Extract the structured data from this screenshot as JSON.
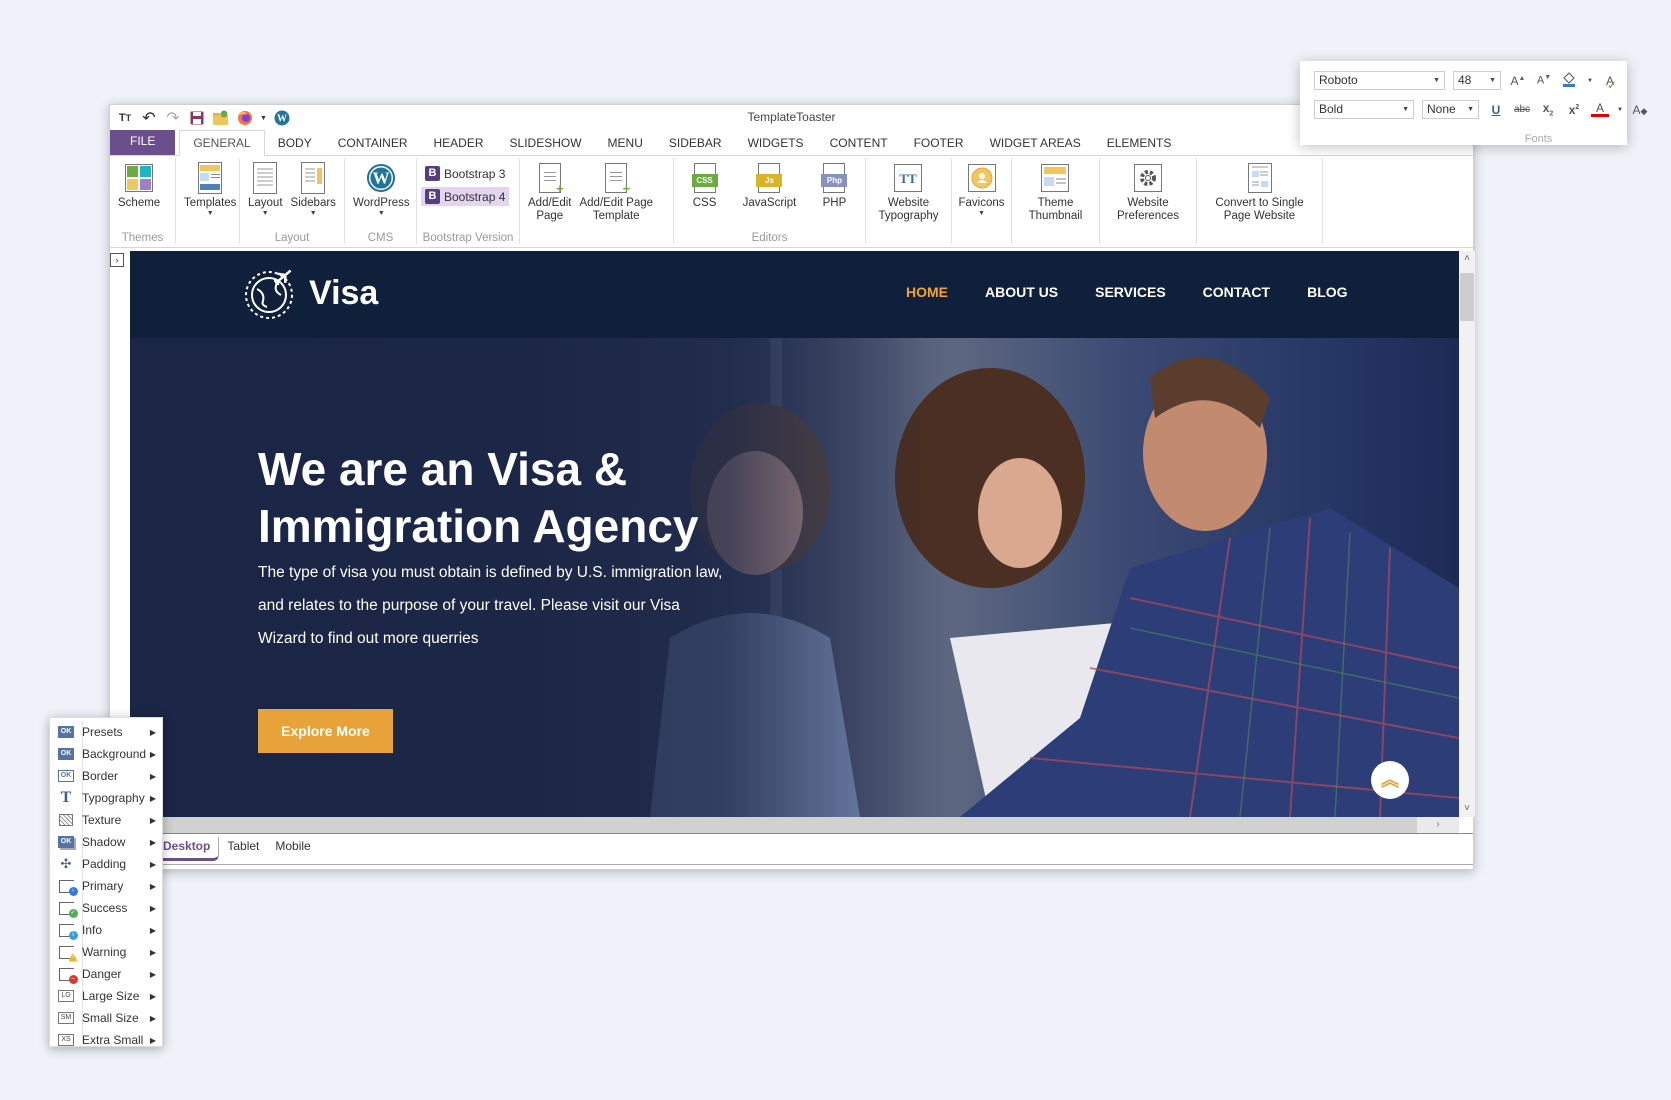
{
  "app": {
    "title": "TemplateToaster",
    "quick_access": [
      {
        "icon": "text-size-icon",
        "glyph": "TT"
      },
      {
        "icon": "undo-icon",
        "glyph": "↶"
      },
      {
        "icon": "redo-icon",
        "glyph": "↷"
      },
      {
        "icon": "save-icon",
        "glyph": "💾"
      },
      {
        "icon": "open-folder-icon",
        "glyph": "📂"
      },
      {
        "icon": "firefox-preview-icon",
        "glyph": "🦊"
      },
      {
        "icon": "wordpress-icon",
        "glyph": "W"
      }
    ]
  },
  "tabs": {
    "file": "FILE",
    "items": [
      "GENERAL",
      "BODY",
      "CONTAINER",
      "HEADER",
      "SLIDESHOW",
      "MENU",
      "SIDEBAR",
      "WIDGETS",
      "CONTENT",
      "FOOTER",
      "WIDGET AREAS",
      "ELEMENTS"
    ],
    "active": "GENERAL"
  },
  "ribbon": {
    "themes": {
      "label": "Themes",
      "scheme": "Scheme"
    },
    "templates": {
      "label": "Templates"
    },
    "layout": {
      "label": "Layout",
      "layout": "Layout",
      "sidebars": "Sidebars"
    },
    "cms": {
      "label": "CMS",
      "wordpress": "WordPress"
    },
    "bootstrap": {
      "label": "Bootstrap Version",
      "b3": "Bootstrap 3",
      "b4": "Bootstrap 4",
      "badge": "B",
      "selected": "Bootstrap 4"
    },
    "pages": {
      "add_edit_page_1": "Add/Edit",
      "add_edit_page_2": "Page",
      "add_edit_tpl_1": "Add/Edit Page",
      "add_edit_tpl_2": "Template"
    },
    "editors": {
      "label": "Editors",
      "css": "CSS",
      "css_badge": "CSS",
      "js": "JavaScript",
      "js_badge": "Js",
      "php": "PHP",
      "php_badge": "Php"
    },
    "typography": {
      "line1": "Website",
      "line2": "Typography"
    },
    "favicons": {
      "label": "Favicons"
    },
    "thumbnail": {
      "line1": "Theme",
      "line2": "Thumbnail"
    },
    "preferences": {
      "line1": "Website",
      "line2": "Preferences"
    },
    "convert": {
      "line1": "Convert to Single",
      "line2": "Page Website"
    }
  },
  "fonts_panel": {
    "font_family": "Roboto",
    "font_size": "48",
    "font_weight": "Bold",
    "decoration": "None",
    "group_label": "Fonts",
    "tools_row1": [
      "grow-font-icon",
      "shrink-font-icon",
      "highlight-color-icon",
      "spellcheck-icon"
    ],
    "tools_row2": [
      "underline-icon",
      "strikethrough-icon",
      "subscript-icon",
      "superscript-icon",
      "font-color-icon",
      "clear-format-icon"
    ],
    "font_color": "#e00000"
  },
  "site": {
    "logo_text": "Visa",
    "nav": [
      {
        "label": "HOME",
        "active": true
      },
      {
        "label": "ABOUT US",
        "active": false
      },
      {
        "label": "SERVICES",
        "active": false
      },
      {
        "label": "CONTACT",
        "active": false
      },
      {
        "label": "BLOG",
        "active": false
      }
    ],
    "hero": {
      "title_line1": "We are an Visa &",
      "title_line2": "Immigration Agency",
      "text": "The type of visa you must obtain is defined by U.S. immigration law, and relates to the purpose of your travel. Please visit our Visa Wizard to find out more querries",
      "button": "Explore More"
    },
    "colors": {
      "header_bg": "#10203a",
      "accent": "#e7a23a",
      "nav_active": "#f1a530"
    }
  },
  "device_tabs": {
    "items": [
      "Desktop",
      "Tablet",
      "Mobile"
    ],
    "active": "Desktop"
  },
  "context_menu": {
    "items": [
      {
        "label": "Presets",
        "icon": "presets-icon"
      },
      {
        "label": "Background",
        "icon": "background-icon"
      },
      {
        "label": "Border",
        "icon": "border-icon"
      },
      {
        "label": "Typography",
        "icon": "typography-icon"
      },
      {
        "label": "Texture",
        "icon": "texture-icon"
      },
      {
        "label": "Shadow",
        "icon": "shadow-icon"
      },
      {
        "label": "Padding",
        "icon": "padding-icon"
      },
      {
        "label": "Primary",
        "icon": "primary-icon"
      },
      {
        "label": "Success",
        "icon": "success-icon"
      },
      {
        "label": "Info",
        "icon": "info-icon"
      },
      {
        "label": "Warning",
        "icon": "warning-icon"
      },
      {
        "label": "Danger",
        "icon": "danger-icon"
      },
      {
        "label": "Large Size",
        "icon": "large-size-icon"
      },
      {
        "label": "Small Size",
        "icon": "small-size-icon"
      },
      {
        "label": "Extra Small",
        "icon": "extra-small-icon"
      }
    ]
  },
  "brand": {
    "purple": "#6b4f8d",
    "bootstrap_purple": "#563d7c"
  }
}
